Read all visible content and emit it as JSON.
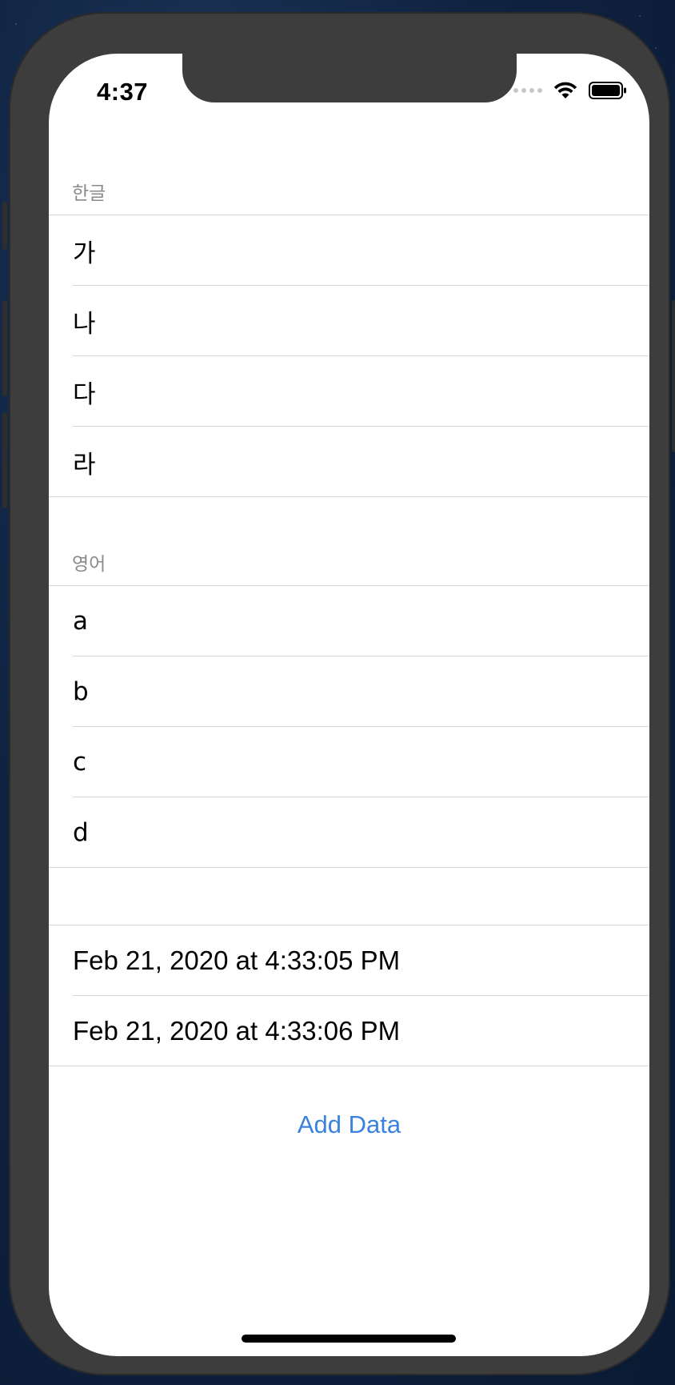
{
  "status_bar": {
    "time": "4:37"
  },
  "sections": [
    {
      "header": "한글",
      "rows": [
        "가",
        "나",
        "다",
        "라"
      ]
    },
    {
      "header": "영어",
      "rows": [
        "a",
        "b",
        "c",
        "d"
      ]
    },
    {
      "header": "",
      "rows": [
        "Feb 21, 2020 at 4:33:05 PM",
        "Feb 21, 2020 at 4:33:06 PM"
      ]
    }
  ],
  "actions": {
    "add_data_label": "Add Data"
  },
  "colors": {
    "accent": "#3a82dd",
    "frame": "#3d3d3d",
    "header_text": "#8a8a8e",
    "separator": "#d9d9dc"
  },
  "icons": {
    "signal": "cellular-signal-icon",
    "wifi": "wifi-icon",
    "battery": "battery-icon"
  }
}
